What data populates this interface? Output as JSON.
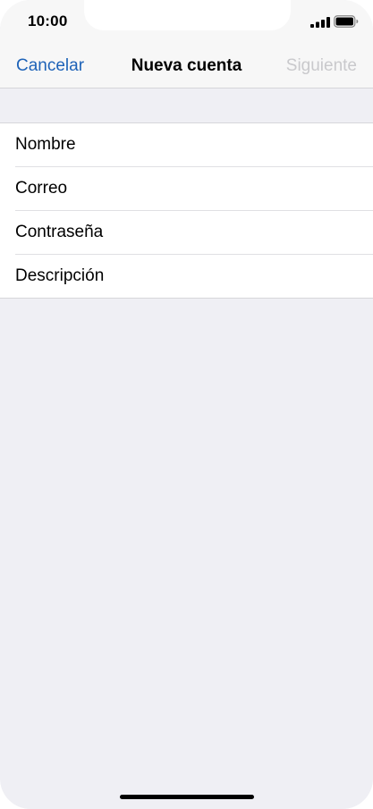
{
  "status_bar": {
    "time": "10:00",
    "icons": [
      "cellular-signal-icon",
      "battery-icon"
    ]
  },
  "nav": {
    "cancel_label": "Cancelar",
    "title": "Nueva cuenta",
    "next_label": "Siguiente"
  },
  "form": {
    "fields": [
      {
        "placeholder": "Nombre",
        "value": ""
      },
      {
        "placeholder": "Correo",
        "value": ""
      },
      {
        "placeholder": "Contraseña",
        "value": ""
      },
      {
        "placeholder": "Descripción",
        "value": ""
      }
    ]
  },
  "colors": {
    "accent": "#1e63b8",
    "disabled": "#c9c9cc",
    "background": "#efeff4",
    "nav_background": "#f7f7f7"
  }
}
